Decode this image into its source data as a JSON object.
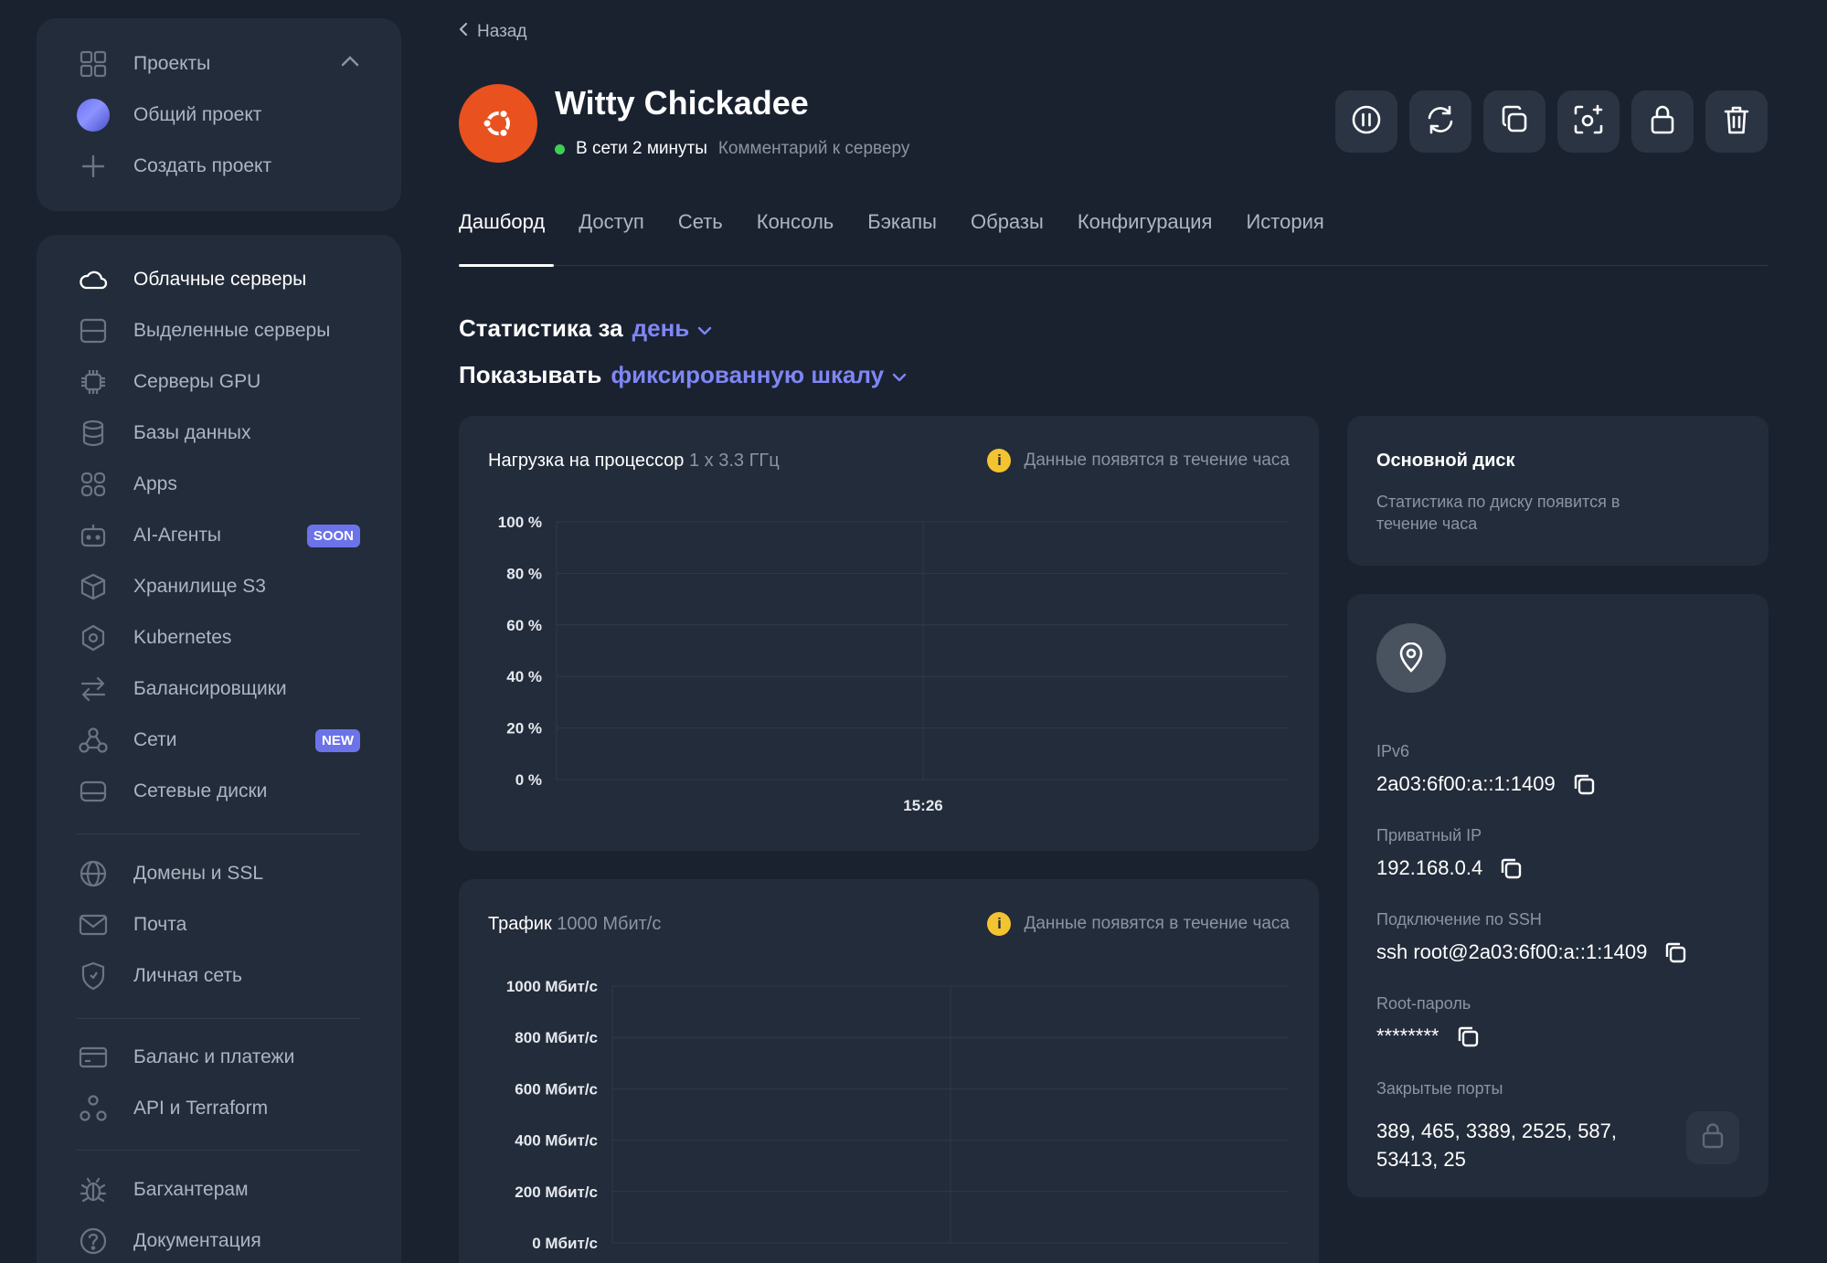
{
  "projects": {
    "header": "Проекты",
    "items": [
      {
        "label": "Общий проект"
      },
      {
        "label": "Создать проект"
      }
    ]
  },
  "nav": {
    "group1": [
      {
        "label": "Облачные серверы",
        "icon": "cloud-icon",
        "active": true
      },
      {
        "label": "Выделенные серверы",
        "icon": "server-icon"
      },
      {
        "label": "Серверы GPU",
        "icon": "chip-icon"
      },
      {
        "label": "Базы данных",
        "icon": "database-icon"
      },
      {
        "label": "Apps",
        "icon": "apps-icon"
      },
      {
        "label": "AI-Агенты",
        "icon": "robot-icon",
        "badge": "SOON"
      },
      {
        "label": "Хранилище S3",
        "icon": "cube-icon"
      },
      {
        "label": "Kubernetes",
        "icon": "kubernetes-icon"
      },
      {
        "label": "Балансировщики",
        "icon": "balancer-icon"
      },
      {
        "label": "Сети",
        "icon": "network-icon",
        "badge": "NEW"
      },
      {
        "label": "Сетевые диски",
        "icon": "disk-icon"
      }
    ],
    "group2": [
      {
        "label": "Домены и SSL",
        "icon": "globe-icon"
      },
      {
        "label": "Почта",
        "icon": "mail-icon"
      },
      {
        "label": "Личная сеть",
        "icon": "shield-icon"
      }
    ],
    "group3": [
      {
        "label": "Баланс и платежи",
        "icon": "card-icon"
      },
      {
        "label": "API и Terraform",
        "icon": "api-icon"
      }
    ],
    "group4": [
      {
        "label": "Багхантерам",
        "icon": "bug-icon"
      },
      {
        "label": "Документация",
        "icon": "help-icon"
      }
    ]
  },
  "back_label": "Назад",
  "server": {
    "name": "Witty Chickadee",
    "status": "В сети 2 минуты",
    "comment": "Комментарий к серверу"
  },
  "actions": [
    "pause-icon",
    "restart-icon",
    "clone-icon",
    "snapshot-icon",
    "lock-icon",
    "trash-icon"
  ],
  "tabs": [
    "Дашборд",
    "Доступ",
    "Сеть",
    "Консоль",
    "Бэкапы",
    "Образы",
    "Конфигурация",
    "История"
  ],
  "stats": {
    "period_prefix": "Статистика за",
    "period_value": "день",
    "scale_prefix": "Показывать",
    "scale_value": "фиксированную шкалу"
  },
  "cpu_card": {
    "title": "Нагрузка на процессор",
    "spec": "1 x 3.3 ГГц",
    "note": "Данные появятся в течение часа"
  },
  "traffic_card": {
    "title": "Трафик",
    "spec": "1000 Мбит/с",
    "note": "Данные появятся в течение часа"
  },
  "chart_data": [
    {
      "type": "line",
      "title": "Нагрузка на процессор",
      "yticks": [
        "100 %",
        "80 %",
        "60 %",
        "40 %",
        "20 %",
        "0 %"
      ],
      "ylim": [
        0,
        100
      ],
      "xticks": [
        "15:26"
      ],
      "series": [],
      "grid": true
    },
    {
      "type": "line",
      "title": "Трафик",
      "yticks": [
        "1000 Мбит/с",
        "800 Мбит/с",
        "600 Мбит/с",
        "400 Мбит/с",
        "200 Мбит/с",
        "0 Мбит/с"
      ],
      "ylim": [
        0,
        1000
      ],
      "xticks": [],
      "series": [],
      "grid": true
    }
  ],
  "disk_card": {
    "title": "Основной диск",
    "subtitle": "Статистика по диску появится в течение часа"
  },
  "info_card": {
    "ipv6_label": "IPv6",
    "ipv6_value": "2a03:6f00:a::1:1409",
    "private_ip_label": "Приватный IP",
    "private_ip_value": "192.168.0.4",
    "ssh_label": "Подключение по SSH",
    "ssh_value": "ssh root@2a03:6f00:a::1:1409",
    "root_label": "Root-пароль",
    "root_value": "********",
    "ports_label": "Закрытые порты",
    "ports_value": "389, 465, 3389, 2525, 587, 53413, 25"
  }
}
